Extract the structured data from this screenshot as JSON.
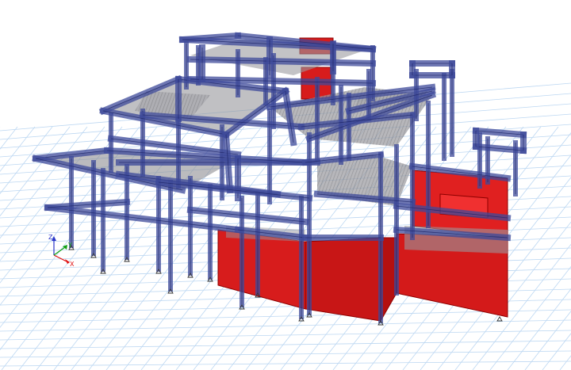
{
  "viewport": {
    "background": "#ffffff",
    "grid_color": "#bcd7f2",
    "frame_color": "#3e4a9a",
    "frame_fill": "rgba(70,82,160,0.55)",
    "slab_color": "#8e8e94",
    "wall_color": "#d71c1c",
    "wall_edge": "#8e0000",
    "support_color": "#333333"
  },
  "axis_triad": {
    "z_label": "Z",
    "x_label": "X",
    "y_label": "Y",
    "z_color": "#2a35c8",
    "x_color": "#e01010",
    "y_color": "#10a010"
  }
}
